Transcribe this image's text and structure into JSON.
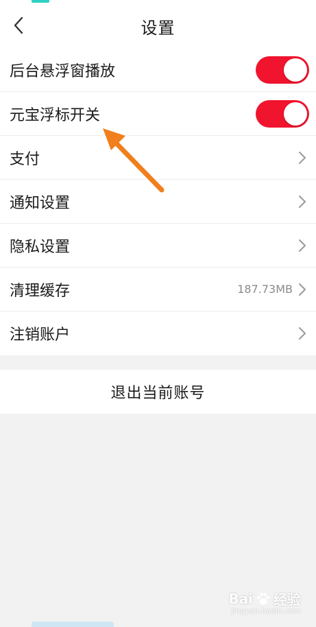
{
  "header": {
    "title": "设置"
  },
  "settings": {
    "items": [
      {
        "label": "后台悬浮窗播放",
        "control": "toggle",
        "on": true
      },
      {
        "label": "元宝浮标开关",
        "control": "toggle",
        "on": true
      },
      {
        "label": "支付",
        "control": "chevron"
      },
      {
        "label": "通知设置",
        "control": "chevron"
      },
      {
        "label": "隐私设置",
        "control": "chevron"
      },
      {
        "label": "清理缓存",
        "control": "chevron",
        "value": "187.73MB"
      },
      {
        "label": "注销账户",
        "control": "chevron"
      }
    ]
  },
  "logout": {
    "label": "退出当前账号"
  },
  "watermark": {
    "brand": "Bai",
    "suffix": "经验",
    "sub": "jingyan.baidu.com"
  },
  "colors": {
    "toggle_on": "#f0142f",
    "annotation_arrow": "#f07f1c",
    "divider": "#ededed",
    "page_bg": "#f2f2f2"
  },
  "icons": {
    "back": "chevron-left-icon",
    "row_arrow": "chevron-right-icon",
    "logo": "paw-icon"
  }
}
